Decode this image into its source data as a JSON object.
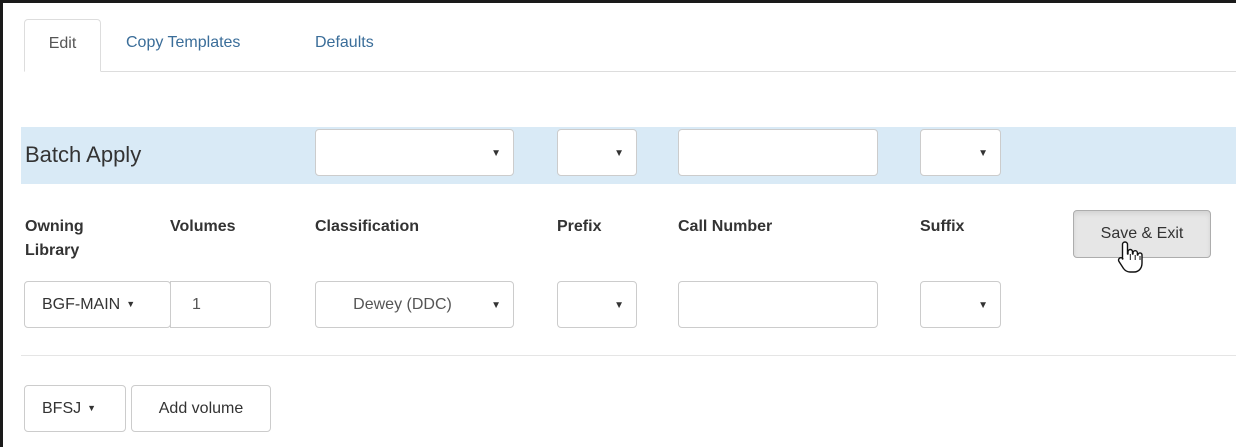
{
  "tabs": [
    {
      "label": "Edit",
      "active": true
    },
    {
      "label": "Copy Templates",
      "active": false
    },
    {
      "label": "Defaults",
      "active": false
    }
  ],
  "batch_apply": {
    "title": "Batch Apply",
    "classification_value": "",
    "prefix_value": "",
    "call_number_value": "",
    "suffix_value": ""
  },
  "columns": {
    "owning_library": "Owning Library",
    "volumes": "Volumes",
    "classification": "Classification",
    "prefix": "Prefix",
    "call_number": "Call Number",
    "suffix": "Suffix"
  },
  "row": {
    "owning_library": "BGF-MAIN",
    "volumes": "1",
    "classification": "Dewey (DDC)",
    "prefix": "",
    "call_number": "",
    "suffix": ""
  },
  "save_exit_label": "Save & Exit",
  "footer": {
    "library_dropdown": "BFSJ",
    "add_volume_label": "Add volume"
  },
  "colors": {
    "band": "#d9eaf6",
    "tab_link": "#3a6d99",
    "button_active": "#e6e6e6"
  },
  "icons": {
    "caret": "caret-down-icon",
    "cursor": "hand-pointer-icon"
  }
}
